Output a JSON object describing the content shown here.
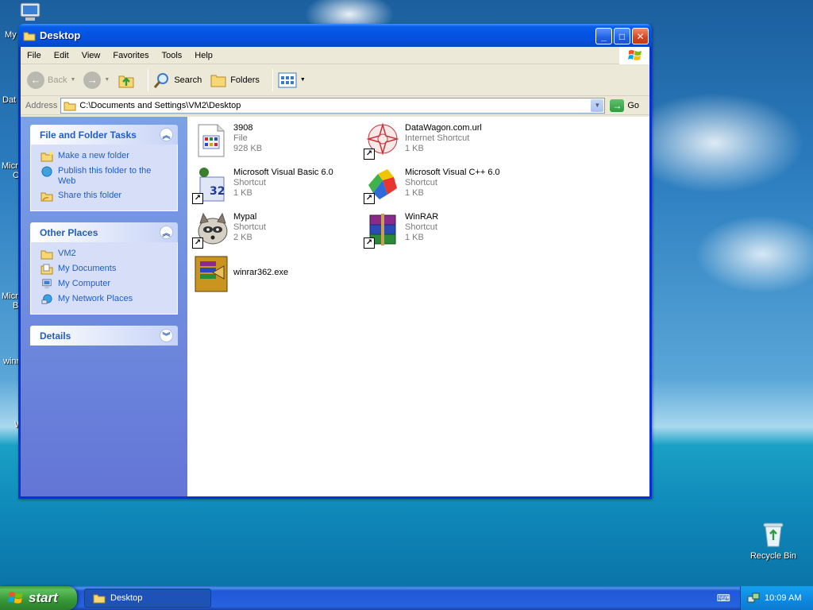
{
  "desktop": {
    "left_icon_fragments": [
      "My",
      "Dat",
      "Micro",
      "C",
      "Micro",
      "B",
      "winr",
      "W"
    ],
    "recycle_bin_label": "Recycle Bin"
  },
  "window": {
    "title": "Desktop",
    "buttons": {
      "minimize": "_",
      "maximize": "□",
      "close": "✕"
    }
  },
  "menu": [
    "File",
    "Edit",
    "View",
    "Favorites",
    "Tools",
    "Help"
  ],
  "toolbar": {
    "back_label": "Back",
    "search_label": "Search",
    "folders_label": "Folders"
  },
  "address": {
    "label": "Address",
    "value": "C:\\Documents and Settings\\VM2\\Desktop",
    "go_label": "Go"
  },
  "taskpane": {
    "file_folder_tasks": {
      "title": "File and Folder Tasks",
      "items": [
        "Make a new folder",
        "Publish this folder to the Web",
        "Share this folder"
      ]
    },
    "other_places": {
      "title": "Other Places",
      "items": [
        "VM2",
        "My Documents",
        "My Computer",
        "My Network Places"
      ]
    },
    "details": {
      "title": "Details"
    }
  },
  "files": [
    {
      "name": "3908",
      "type": "File",
      "size": "928 KB"
    },
    {
      "name": "DataWagon.com.url",
      "type": "Internet Shortcut",
      "size": "1 KB"
    },
    {
      "name": "Microsoft Visual Basic 6.0",
      "type": "Shortcut",
      "size": "1 KB"
    },
    {
      "name": "Microsoft Visual C++ 6.0",
      "type": "Shortcut",
      "size": "1 KB"
    },
    {
      "name": "Mypal",
      "type": "Shortcut",
      "size": "2 KB"
    },
    {
      "name": "WinRAR",
      "type": "Shortcut",
      "size": "1 KB"
    },
    {
      "name": "winrar362.exe",
      "type": "",
      "size": ""
    }
  ],
  "taskbar": {
    "start_label": "start",
    "task_button_label": "Desktop",
    "clock": "10:09 AM"
  },
  "colors": {
    "title_blue": "#0554e3",
    "task_link_blue": "#215dc6",
    "start_green": "#369636",
    "tray_blue": "#0f8be2"
  }
}
